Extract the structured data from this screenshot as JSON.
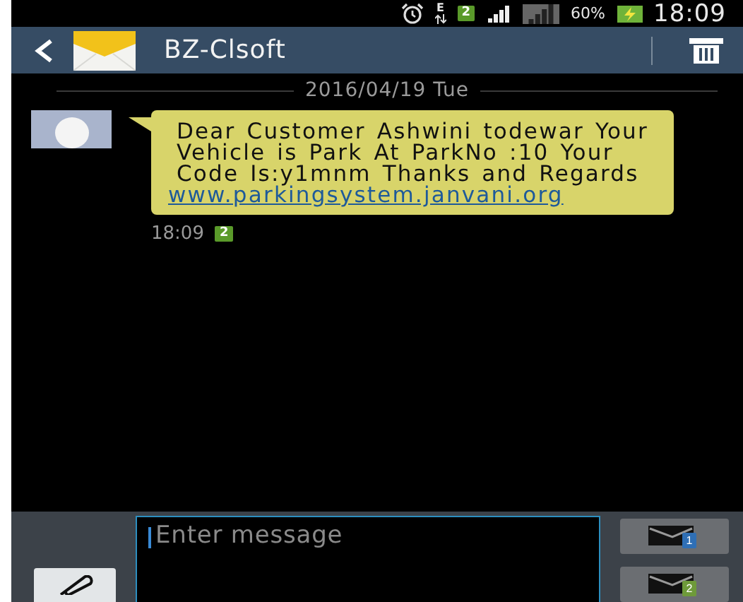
{
  "status_bar": {
    "network": "E",
    "sim": "2",
    "battery": "60%",
    "time": "18:09"
  },
  "header": {
    "title": "BZ-Clsoft"
  },
  "conversation": {
    "date": "2016/04/19 Tue",
    "messages": [
      {
        "text": "Dear Customer Ashwini todewar Your Vehicle is Park At ParkNo :10 Your Code Is:y1mnm Thanks and Regards",
        "link": "www.parkingsystem.janvani.org",
        "time": "18:09",
        "sim": "2"
      }
    ]
  },
  "composer": {
    "placeholder": "Enter message",
    "send_buttons": [
      {
        "sim": "1",
        "color": "#2f6fb5"
      },
      {
        "sim": "2",
        "color": "#6e9a3a"
      }
    ]
  }
}
